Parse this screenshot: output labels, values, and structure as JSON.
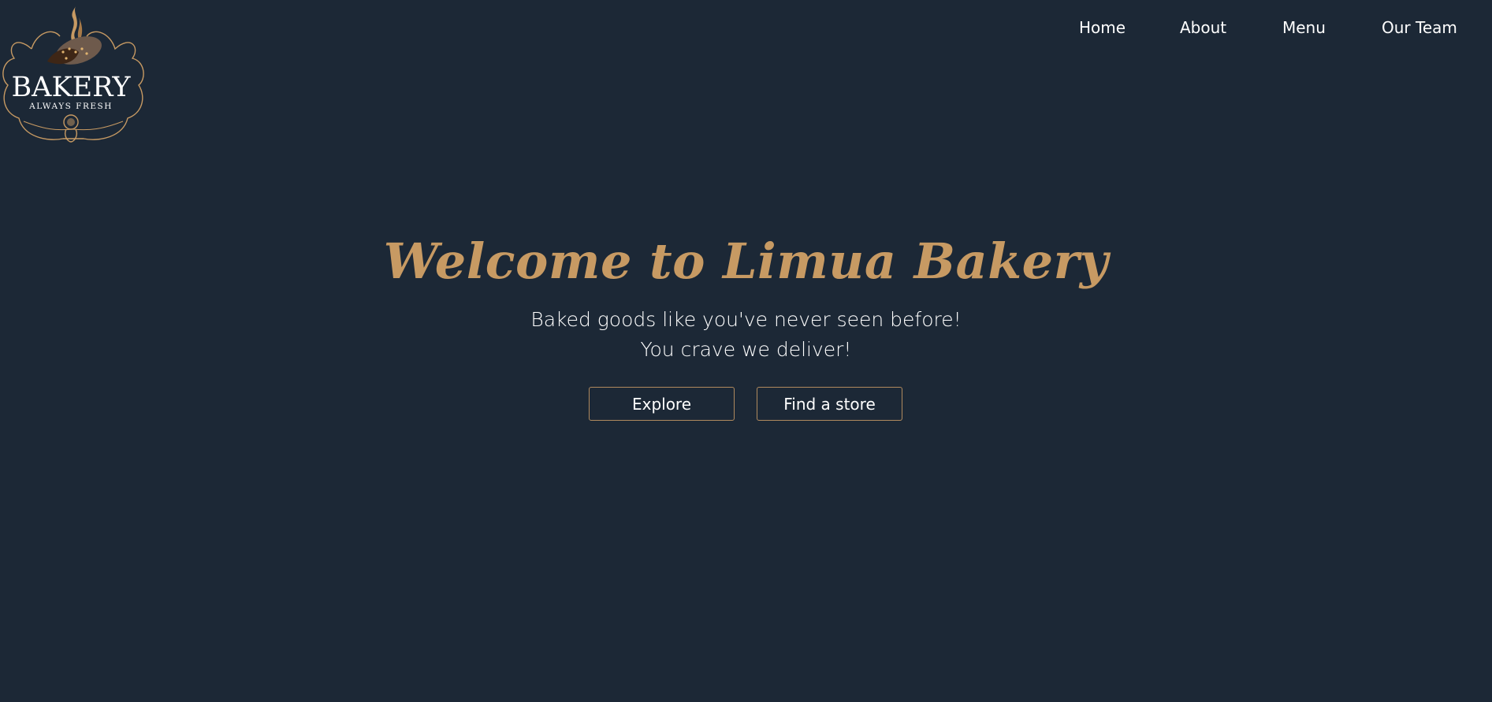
{
  "logo": {
    "title": "BAKERY",
    "tagline": "ALWAYS FRESH",
    "icon": "bakery-logo-icon"
  },
  "nav": {
    "items": [
      {
        "label": "Home"
      },
      {
        "label": "About"
      },
      {
        "label": "Menu"
      },
      {
        "label": "Our Team"
      }
    ]
  },
  "hero": {
    "title": "Welcome to Limua Bakery",
    "subtitle_line1": "Baked goods like you've never seen before!",
    "subtitle_line2": "You crave we deliver!",
    "explore_label": "Explore",
    "find_store_label": "Find a store"
  },
  "colors": {
    "background": "#1c2836",
    "accent": "#c79a63",
    "text": "#ffffff"
  }
}
